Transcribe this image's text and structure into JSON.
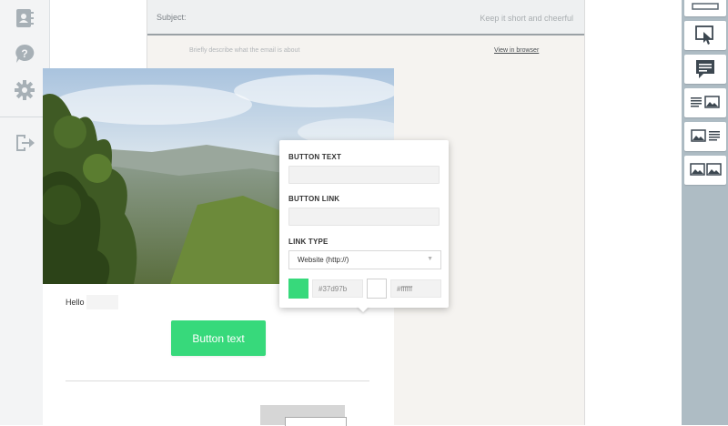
{
  "app": {
    "accent_color": "#37d97b"
  },
  "sidebar": {
    "items": [
      {
        "name": "contacts",
        "icon": "contacts-book-icon"
      },
      {
        "name": "help",
        "icon": "help-icon"
      },
      {
        "name": "settings",
        "icon": "gear-icon"
      },
      {
        "name": "logout",
        "icon": "logout-icon"
      }
    ]
  },
  "subject": {
    "label": "Subject:",
    "placeholder": "Keep it short and cheerful",
    "value": ""
  },
  "preheader": {
    "placeholder": "Briefly describe what the email is about",
    "view_link": "View in browser"
  },
  "email": {
    "hero_image": "landscape-photo",
    "greeting": "Hello",
    "button_label": "Button text"
  },
  "popover": {
    "button_text_label": "BUTTON TEXT",
    "button_text_value": "",
    "button_link_label": "BUTTON LINK",
    "button_link_value": "",
    "link_type_label": "LINK TYPE",
    "link_type_selected": "Website (http://)",
    "background_color": "#37d97b",
    "text_color": "#ffffff"
  },
  "blocks_panel": {
    "tiles": [
      {
        "name": "divider-block",
        "icon": "divider-icon"
      },
      {
        "name": "button-block",
        "icon": "button-click-icon"
      },
      {
        "name": "text-block",
        "icon": "text-comment-icon"
      },
      {
        "name": "text-image-block",
        "icon": "text-image-icon"
      },
      {
        "name": "image-text-block",
        "icon": "image-text-icon"
      },
      {
        "name": "two-images-block",
        "icon": "two-images-icon"
      }
    ]
  }
}
